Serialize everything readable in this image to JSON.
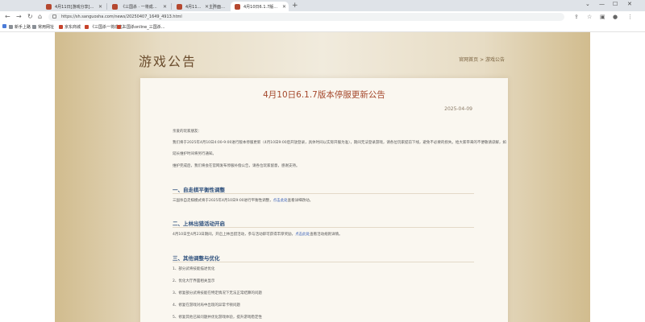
{
  "browser": {
    "tabs": [
      {
        "label": "4月11日[游戏分享]版本公告",
        "active": false
      },
      {
        "label": "《三国杀 · 一将成名》官方网站",
        "active": false
      },
      {
        "label": "4月11日pc一键版",
        "active": false
      },
      {
        "label": "主界面的……",
        "active": false
      },
      {
        "label": "4月10日6.1.7版本停服更新公告",
        "active": true
      }
    ],
    "new_tab": "+",
    "window_controls": [
      "⌄",
      "—",
      "☐",
      "✕"
    ],
    "url": "https://sh.sanguosha.com/news/20250407_1649_4913.html",
    "bookmarks": [
      {
        "label": "",
        "icon": "apps"
      },
      {
        "label": "新手上路",
        "icon": "folder"
      },
      {
        "label": "常用网址",
        "icon": "folder"
      },
      {
        "label": "京东商城",
        "icon": "red"
      },
      {
        "label": "《三国杀一将成名》",
        "icon": "red"
      },
      {
        "label": "三国杀online_三国杀...",
        "icon": "red"
      }
    ]
  },
  "page": {
    "section_title": "游戏公告",
    "breadcrumb": "官网首页 > 游戏公告",
    "article": {
      "title": "4月10日6.1.7版本停服更新公告",
      "date": "2025-04-09",
      "greeting": "亲爱的玩家朋友：",
      "intro_line1": "我们将于2025年4月10日4:00-9:00进行版本停服更新（4月10日9:00后开放登录，具体时间以实际开服为准），期间无法登录游戏，请各位玩家提前下线，避免不必要的损失。给大家带来的不便敬请谅解，如",
      "intro_line2": "延长维护时间将另行通知。",
      "intro_line3": "维护完成后，我们将会在官网发布停服补偿公告，请各位玩家留意，感谢支持。",
      "sections": [
        {
          "heading": "一、自走棋平衡性调整",
          "body_before_link": "三国杀自走棋模式将于2025年4月10日9:00进行平衡性调整，",
          "link": "点击此处",
          "body_after_link": "查看详细改动。"
        },
        {
          "heading": "二、上林出猎活动开启",
          "body_before_link": "4月10日至4月23日期间，开启上林出猎活动，参与活动即可获得丰厚奖励，",
          "link": "点击此处",
          "body_after_link": "查看活动规则详情。"
        },
        {
          "heading": "三、其他调整与优化",
          "items": [
            "1、部分武将技能描述优化",
            "2、优化大厅界面相关显示",
            "3、修复部分武将技能在特定情况下无法正常结算的问题",
            "4、修复在游戏对局中出现的异常卡顿问题",
            "5、修复其他已知问题并优化游戏体验，提升游戏稳定性"
          ]
        }
      ]
    }
  }
}
